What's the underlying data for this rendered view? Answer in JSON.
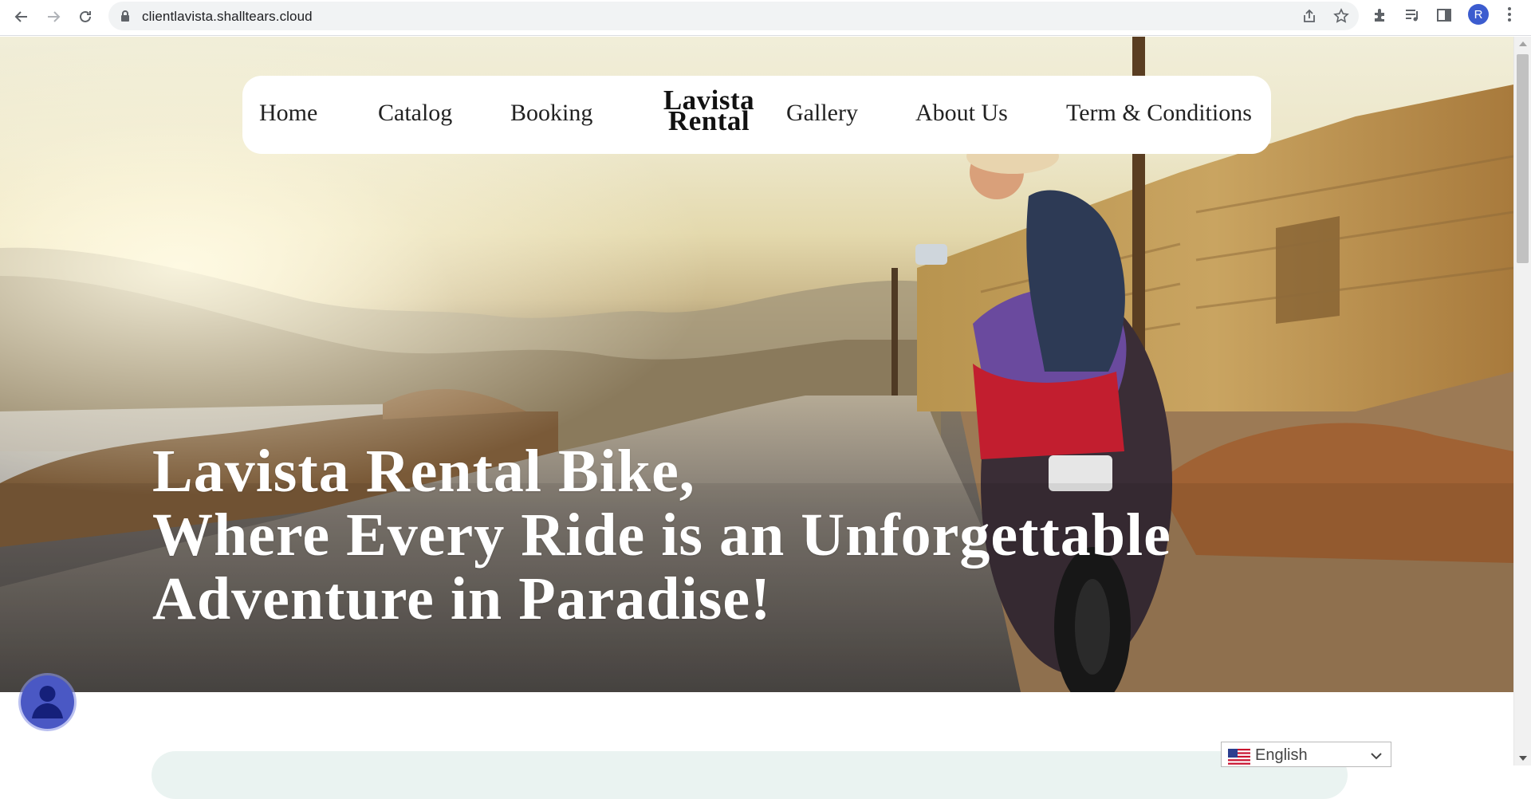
{
  "browser": {
    "url": "clientlavista.shalltears.cloud",
    "profile_initial": "R",
    "icons": [
      "back-icon",
      "forward-icon",
      "reload-icon",
      "lock-icon",
      "share-icon",
      "star-icon",
      "extensions-icon",
      "media-icon",
      "side-panel-icon",
      "menu-icon"
    ]
  },
  "nav": {
    "items_left": [
      "Home",
      "Catalog",
      "Booking"
    ],
    "brand_line1": "Lavista",
    "brand_line2": "Rental",
    "items_right": [
      "Gallery",
      "About Us",
      "Term & Conditions"
    ]
  },
  "hero": {
    "line1": "Lavista Rental Bike,",
    "line2": "Where Every Ride is an Unforgettable",
    "line3": "Adventure in Paradise!"
  },
  "language": {
    "selected": "English",
    "flag": "us-flag-icon"
  },
  "colors": {
    "nav_bg": "#ffffff",
    "headline": "#ffffff",
    "avatar_bg": "#4a58c4",
    "profile_bg": "#3c5ccf",
    "section_bg": "#eaf3f1"
  }
}
